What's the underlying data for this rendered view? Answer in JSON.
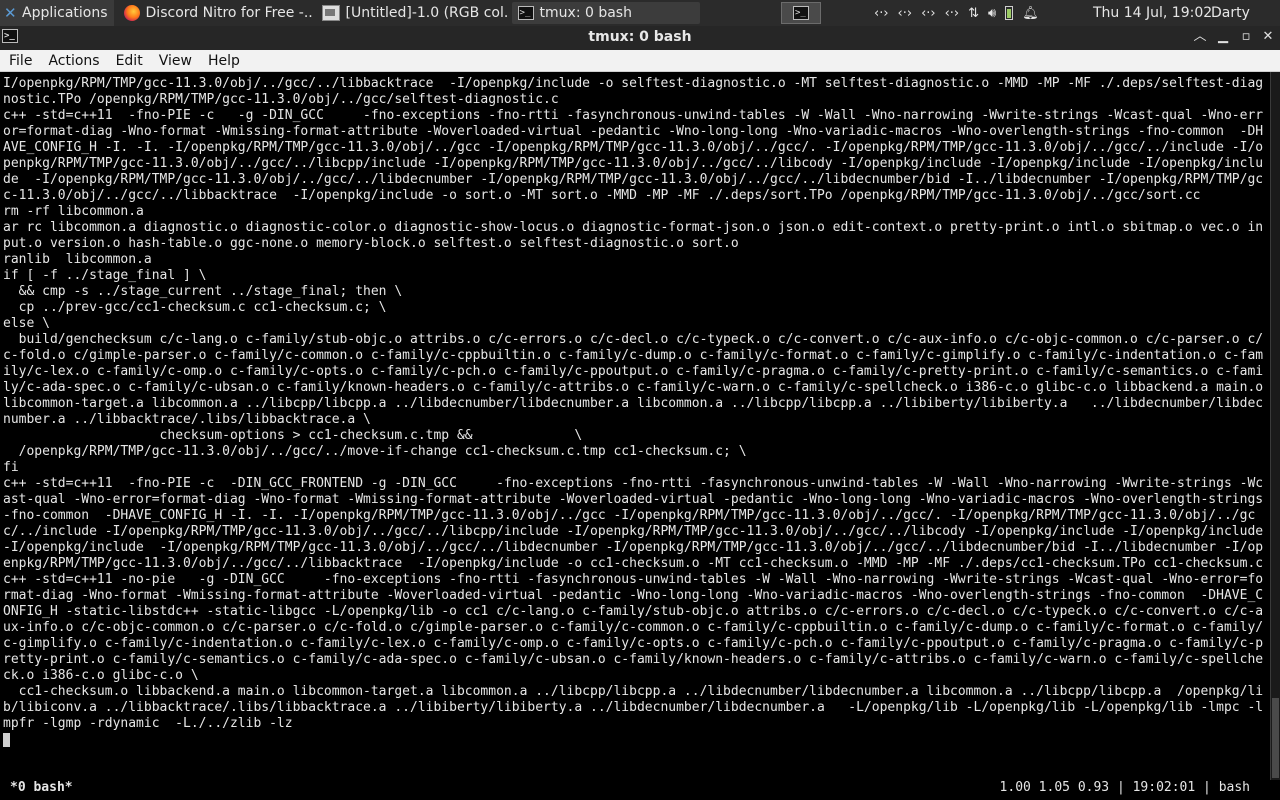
{
  "panel": {
    "apps_label": "Applications",
    "tasks": [
      {
        "label": "Discord Nitro for Free -...",
        "icon": "firefox-icon"
      },
      {
        "label": "[Untitled]-1.0 (RGB col...",
        "icon": "gimp-icon"
      },
      {
        "label": "tmux: 0 bash",
        "icon": "terminal-icon"
      }
    ],
    "clock": "Thu 14 Jul, 19:02",
    "user": "Darty uwu"
  },
  "window": {
    "title": "tmux: 0 bash"
  },
  "menu": {
    "items": [
      "File",
      "Actions",
      "Edit",
      "View",
      "Help"
    ]
  },
  "terminal": {
    "output": "I/openpkg/RPM/TMP/gcc-11.3.0/obj/../gcc/../libbacktrace  -I/openpkg/include -o selftest-diagnostic.o -MT selftest-diagnostic.o -MMD -MP -MF ./.deps/selftest-diagnostic.TPo /openpkg/RPM/TMP/gcc-11.3.0/obj/../gcc/selftest-diagnostic.c\nc++ -std=c++11  -fno-PIE -c   -g -DIN_GCC     -fno-exceptions -fno-rtti -fasynchronous-unwind-tables -W -Wall -Wno-narrowing -Wwrite-strings -Wcast-qual -Wno-error=format-diag -Wno-format -Wmissing-format-attribute -Woverloaded-virtual -pedantic -Wno-long-long -Wno-variadic-macros -Wno-overlength-strings -fno-common  -DHAVE_CONFIG_H -I. -I. -I/openpkg/RPM/TMP/gcc-11.3.0/obj/../gcc -I/openpkg/RPM/TMP/gcc-11.3.0/obj/../gcc/. -I/openpkg/RPM/TMP/gcc-11.3.0/obj/../gcc/../include -I/openpkg/RPM/TMP/gcc-11.3.0/obj/../gcc/../libcpp/include -I/openpkg/RPM/TMP/gcc-11.3.0/obj/../gcc/../libcody -I/openpkg/include -I/openpkg/include -I/openpkg/include  -I/openpkg/RPM/TMP/gcc-11.3.0/obj/../gcc/../libdecnumber -I/openpkg/RPM/TMP/gcc-11.3.0/obj/../gcc/../libdecnumber/bid -I../libdecnumber -I/openpkg/RPM/TMP/gcc-11.3.0/obj/../gcc/../libbacktrace  -I/openpkg/include -o sort.o -MT sort.o -MMD -MP -MF ./.deps/sort.TPo /openpkg/RPM/TMP/gcc-11.3.0/obj/../gcc/sort.cc\nrm -rf libcommon.a\nar rc libcommon.a diagnostic.o diagnostic-color.o diagnostic-show-locus.o diagnostic-format-json.o json.o edit-context.o pretty-print.o intl.o sbitmap.o vec.o input.o version.o hash-table.o ggc-none.o memory-block.o selftest.o selftest-diagnostic.o sort.o\nranlib  libcommon.a\nif [ -f ../stage_final ] \\\n  && cmp -s ../stage_current ../stage_final; then \\\n  cp ../prev-gcc/cc1-checksum.c cc1-checksum.c; \\\nelse \\\n  build/genchecksum c/c-lang.o c-family/stub-objc.o attribs.o c/c-errors.o c/c-decl.o c/c-typeck.o c/c-convert.o c/c-aux-info.o c/c-objc-common.o c/c-parser.o c/c-fold.o c/gimple-parser.o c-family/c-common.o c-family/c-cppbuiltin.o c-family/c-dump.o c-family/c-format.o c-family/c-gimplify.o c-family/c-indentation.o c-family/c-lex.o c-family/c-omp.o c-family/c-opts.o c-family/c-pch.o c-family/c-ppoutput.o c-family/c-pragma.o c-family/c-pretty-print.o c-family/c-semantics.o c-family/c-ada-spec.o c-family/c-ubsan.o c-family/known-headers.o c-family/c-attribs.o c-family/c-warn.o c-family/c-spellcheck.o i386-c.o glibc-c.o libbackend.a main.o libcommon-target.a libcommon.a ../libcpp/libcpp.a ../libdecnumber/libdecnumber.a libcommon.a ../libcpp/libcpp.a ../libiberty/libiberty.a   ../libdecnumber/libdecnumber.a ../libbacktrace/.libs/libbacktrace.a \\\n                    checksum-options > cc1-checksum.c.tmp &&             \\\n  /openpkg/RPM/TMP/gcc-11.3.0/obj/../gcc/../move-if-change cc1-checksum.c.tmp cc1-checksum.c; \\\nfi\nc++ -std=c++11  -fno-PIE -c  -DIN_GCC_FRONTEND -g -DIN_GCC     -fno-exceptions -fno-rtti -fasynchronous-unwind-tables -W -Wall -Wno-narrowing -Wwrite-strings -Wcast-qual -Wno-error=format-diag -Wno-format -Wmissing-format-attribute -Woverloaded-virtual -pedantic -Wno-long-long -Wno-variadic-macros -Wno-overlength-strings -fno-common  -DHAVE_CONFIG_H -I. -I. -I/openpkg/RPM/TMP/gcc-11.3.0/obj/../gcc -I/openpkg/RPM/TMP/gcc-11.3.0/obj/../gcc/. -I/openpkg/RPM/TMP/gcc-11.3.0/obj/../gcc/../include -I/openpkg/RPM/TMP/gcc-11.3.0/obj/../gcc/../libcpp/include -I/openpkg/RPM/TMP/gcc-11.3.0/obj/../gcc/../libcody -I/openpkg/include -I/openpkg/include -I/openpkg/include  -I/openpkg/RPM/TMP/gcc-11.3.0/obj/../gcc/../libdecnumber -I/openpkg/RPM/TMP/gcc-11.3.0/obj/../gcc/../libdecnumber/bid -I../libdecnumber -I/openpkg/RPM/TMP/gcc-11.3.0/obj/../gcc/../libbacktrace  -I/openpkg/include -o cc1-checksum.o -MT cc1-checksum.o -MMD -MP -MF ./.deps/cc1-checksum.TPo cc1-checksum.c\nc++ -std=c++11 -no-pie   -g -DIN_GCC     -fno-exceptions -fno-rtti -fasynchronous-unwind-tables -W -Wall -Wno-narrowing -Wwrite-strings -Wcast-qual -Wno-error=format-diag -Wno-format -Wmissing-format-attribute -Woverloaded-virtual -pedantic -Wno-long-long -Wno-variadic-macros -Wno-overlength-strings -fno-common  -DHAVE_CONFIG_H -static-libstdc++ -static-libgcc -L/openpkg/lib -o cc1 c/c-lang.o c-family/stub-objc.o attribs.o c/c-errors.o c/c-decl.o c/c-typeck.o c/c-convert.o c/c-aux-info.o c/c-objc-common.o c/c-parser.o c/c-fold.o c/gimple-parser.o c-family/c-common.o c-family/c-cppbuiltin.o c-family/c-dump.o c-family/c-format.o c-family/c-gimplify.o c-family/c-indentation.o c-family/c-lex.o c-family/c-omp.o c-family/c-opts.o c-family/c-pch.o c-family/c-ppoutput.o c-family/c-pragma.o c-family/c-pretty-print.o c-family/c-semantics.o c-family/c-ada-spec.o c-family/c-ubsan.o c-family/known-headers.o c-family/c-attribs.o c-family/c-warn.o c-family/c-spellcheck.o i386-c.o glibc-c.o \\\n  cc1-checksum.o libbackend.a main.o libcommon-target.a libcommon.a ../libcpp/libcpp.a ../libdecnumber/libdecnumber.a libcommon.a ../libcpp/libcpp.a  /openpkg/lib/libiconv.a ../libbacktrace/.libs/libbacktrace.a ../libiberty/libiberty.a ../libdecnumber/libdecnumber.a   -L/openpkg/lib -L/openpkg/lib -L/openpkg/lib -lmpc -lmpfr -lgmp -rdynamic  -L./../zlib -lz"
  },
  "status": {
    "left": "*0 bash*",
    "right": "1.00 1.05 0.93 | 19:02:01 | bash"
  }
}
